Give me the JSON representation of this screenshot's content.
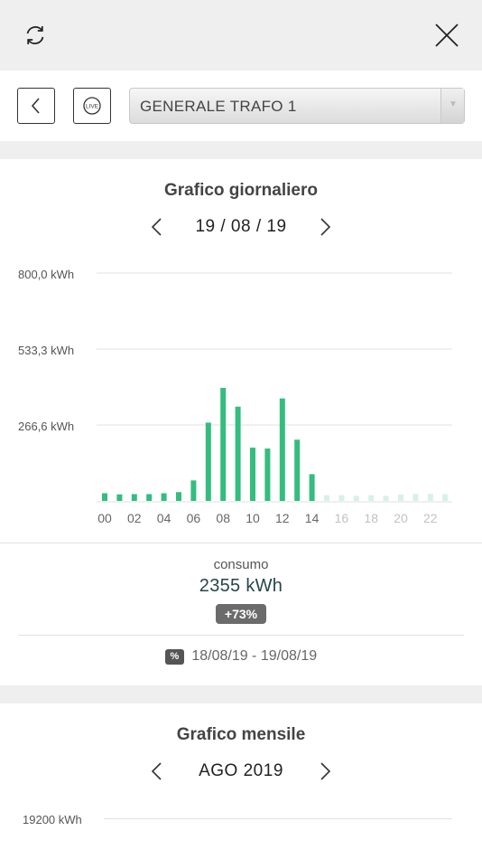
{
  "header": {
    "refresh_icon": "refresh-icon",
    "close_icon": "close-icon"
  },
  "toolbar": {
    "back_icon": "chevron-left-icon",
    "live_icon": "live-icon",
    "live_label": "LIVE",
    "selector_value": "GENERALE TRAFO 1",
    "selector_arrow": "▼"
  },
  "daily": {
    "title": "Grafico giornaliero",
    "date": "19 / 08 / 19",
    "consumo_label": "consumo",
    "consumo_value": "2355 kWh",
    "change_badge": "+73%",
    "compare_icon_label": "%",
    "compare_range": "18/08/19 - 19/08/19"
  },
  "monthly": {
    "title": "Grafico mensile",
    "date": "AGO 2019",
    "y_top_label": "19200 kWh"
  },
  "colors": {
    "bar_active": "#33bd7f",
    "bar_future": "#d6f2e5",
    "grid": "#e1e1e1",
    "badge": "#6b6b6b"
  },
  "chart_data": {
    "type": "bar",
    "title": "Grafico giornaliero",
    "unit": "kWh",
    "ylim": [
      0,
      800
    ],
    "yticks": [
      0,
      266.6,
      533.3,
      800
    ],
    "ytick_labels": [
      "",
      "266,6 kWh",
      "533,3 kWh",
      "800,0 kWh"
    ],
    "xtick_labels": [
      "00",
      "02",
      "04",
      "06",
      "08",
      "10",
      "12",
      "14",
      "16",
      "18",
      "20",
      "22"
    ],
    "categories": [
      "00",
      "01",
      "02",
      "03",
      "04",
      "05",
      "06",
      "07",
      "08",
      "09",
      "10",
      "11",
      "12",
      "13",
      "14",
      "15",
      "16",
      "17",
      "18",
      "19",
      "20",
      "21",
      "22",
      "23"
    ],
    "values": [
      27,
      23,
      24,
      24,
      27,
      31,
      72,
      275,
      397,
      331,
      187,
      184,
      360,
      215,
      94,
      20,
      20,
      18,
      20,
      18,
      22,
      25,
      25,
      24
    ],
    "future_from_index": 15,
    "grid": true
  }
}
